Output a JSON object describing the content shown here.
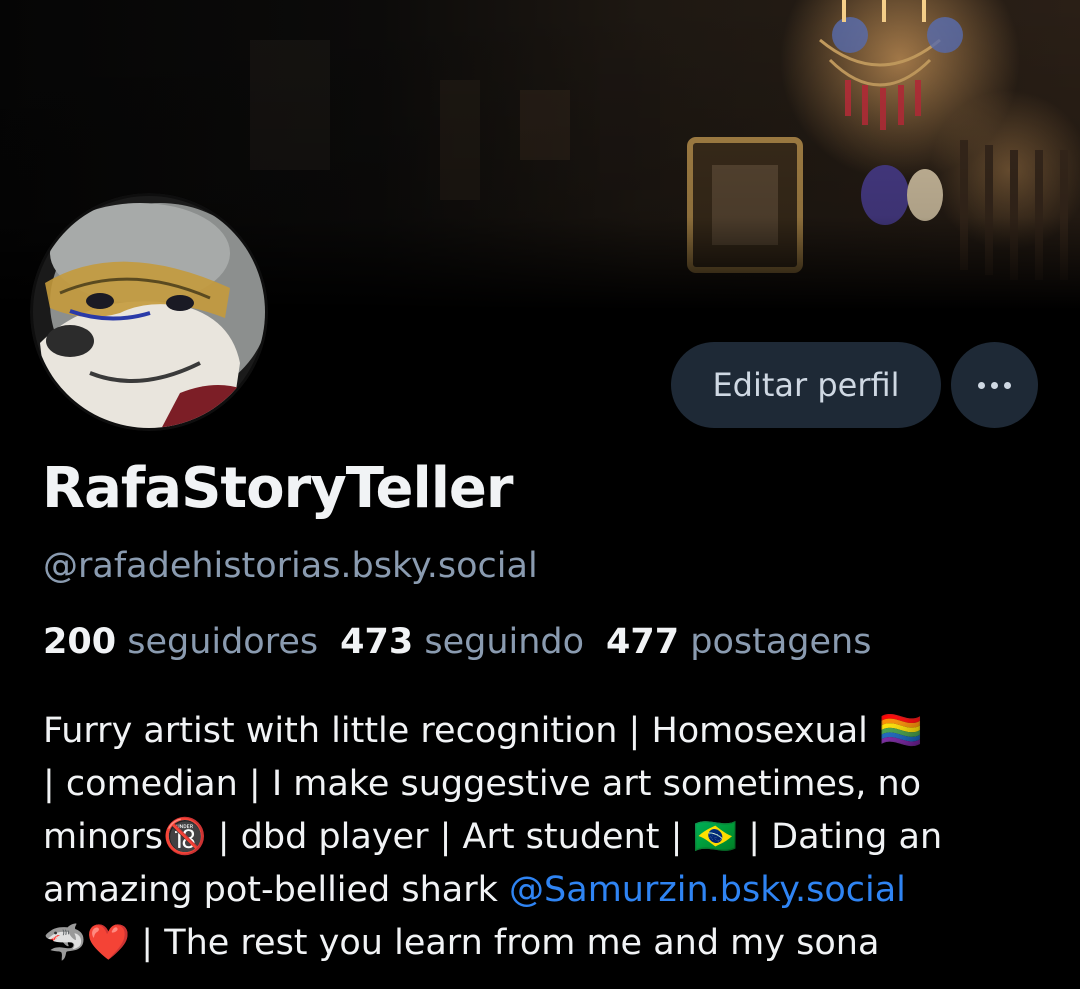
{
  "banner": {
    "description_icon": "banner-image"
  },
  "avatar": {
    "icon": "avatar-image"
  },
  "actions": {
    "edit_profile_label": "Editar perfil",
    "more_icon": "more-options-icon"
  },
  "profile": {
    "display_name": "RafaStoryTeller",
    "handle": "@rafadehistorias.bsky.social"
  },
  "stats": {
    "followers_count": "200",
    "followers_label": "seguidores",
    "following_count": "473",
    "following_label": "seguindo",
    "posts_count": "477",
    "posts_label": "postagens"
  },
  "bio": {
    "line1": "Furry artist with little recognition | Homosexual 🏳️‍🌈",
    "line2": "| comedian | I make suggestive art sometimes, no",
    "line3": "minors🔞 | dbd player | Art student | 🇧🇷 | Dating an",
    "line4_text": "amazing pot-bellied shark ",
    "line4_mention": "@Samurzin.bsky.social",
    "line5": "🦈❤️ | The rest you learn from me and my sona"
  },
  "colors": {
    "background": "#000000",
    "button_bg": "#1e2936",
    "muted_text": "#8a9bb0",
    "mention": "#2f84f3"
  }
}
